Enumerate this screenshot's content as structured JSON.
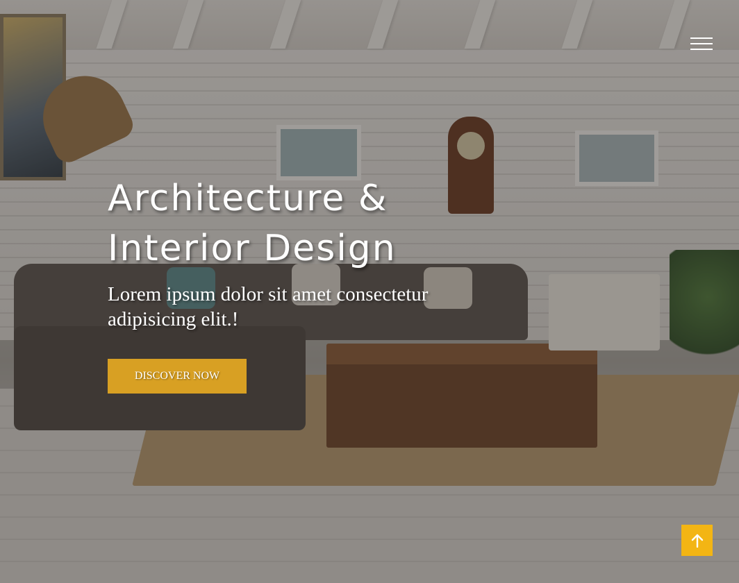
{
  "header": {
    "menu_icon": "hamburger-menu-icon"
  },
  "hero": {
    "title_line1": "Architecture &",
    "title_line2": "Interior Design",
    "subtitle": "Lorem ipsum dolor sit amet consectetur adipisicing elit.!",
    "cta_label": "DISCOVER NOW"
  },
  "scroll_top": {
    "icon": "arrow-up-icon"
  },
  "colors": {
    "accent": "#d8a023",
    "scroll_top_bg": "#f3b514",
    "text": "#ffffff"
  }
}
